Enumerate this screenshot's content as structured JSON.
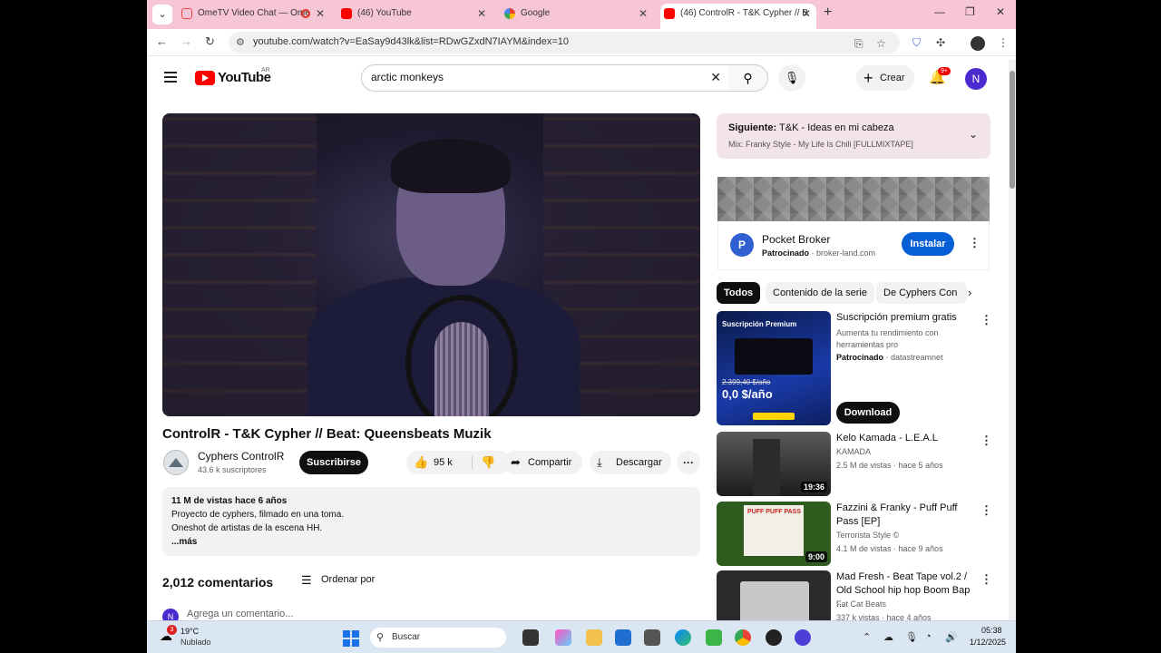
{
  "browser": {
    "tabs": [
      {
        "title": "OmeTV Video Chat — Ome",
        "favicon": "ometv-icon"
      },
      {
        "title": "(46) YouTube",
        "favicon": "youtube-icon"
      },
      {
        "title": "Google",
        "favicon": "google-icon"
      },
      {
        "title": "(46) ControlR - T&K Cypher // B",
        "favicon": "youtube-icon"
      }
    ],
    "url": "youtube.com/watch?v=EaSay9d43lk&list=RDwGZxdN7IAYM&index=10"
  },
  "header": {
    "logo_text": "YouTube",
    "country": "AR",
    "search_value": "arctic monkeys",
    "create_label": "Crear",
    "notif_badge": "9+",
    "avatar_initial": "N"
  },
  "video": {
    "title": "ControlR - T&K Cypher // Beat: Queensbeats Muzik",
    "channel": "Cyphers ControlR",
    "subscribers": "43.6 k suscriptores",
    "subscribe_label": "Suscribirse",
    "likes": "95 k",
    "share_label": "Compartir",
    "download_label": "Descargar",
    "views_meta": "11 M de vistas  hace 6 años",
    "desc_line1": "Proyecto de cyphers, filmado en una toma.",
    "desc_line2": "Oneshot de artistas de la escena HH.",
    "more_label": "...más"
  },
  "comments": {
    "count": "2,012 comentarios",
    "sort_label": "Ordenar por",
    "avatar_initial": "N",
    "placeholder": "Agrega un comentario..."
  },
  "playlist": {
    "next_label": "Siguiente:",
    "next_title": "T&K - Ideas en mi cabeza",
    "mix_title": "Mix: Franky Style - My Life Is Chili [FULLMIXTAPE]"
  },
  "ad": {
    "logo_letter": "P",
    "name": "Pocket Broker",
    "sponsored": "Patrocinado",
    "domain": "· broker-land.com",
    "install_label": "Instalar"
  },
  "chips": [
    "Todos",
    "Contenido de la serie",
    "De Cyphers Con"
  ],
  "recommendations": [
    {
      "title": "Suscripción premium gratis",
      "line2": "Aumenta tu rendimiento con herramientas pro",
      "sponsored": "Patrocinado",
      "channel": "· datastreamnet",
      "thumb_headline": "Suscripción Premium",
      "thumb_price_old": "2.399,40 $/año",
      "thumb_price": "0,0 $/año",
      "button": "Download"
    },
    {
      "title": "Kelo Kamada - L.E.A.L",
      "channel": "KAMADA",
      "views": "2.5 M de vistas · hace 5 años",
      "duration": "19:36"
    },
    {
      "title": "Fazzini & Franky - Puff Puff Pass [EP]",
      "channel": "Terrorista Style ©",
      "views": "4.1 M de vistas · hace 9 años",
      "duration": "9:00",
      "thumb_text": "PUFF PUFF PASS"
    },
    {
      "title": "Mad Fresh - Beat Tape vol.2 / Old School hip hop Boom Bap ...",
      "channel": "Fat Cat Beats",
      "views": "337 k vistas · hace 4 años"
    }
  ],
  "taskbar": {
    "weather_badge": "3",
    "temp": "19°C",
    "weather": "Nublado",
    "search_label": "Buscar",
    "time": "05:38",
    "date": "1/12/2025"
  },
  "colors": {
    "tabbar": "#f7c6d6",
    "youtube_red": "#ff0000",
    "install_blue": "#065fd4"
  }
}
